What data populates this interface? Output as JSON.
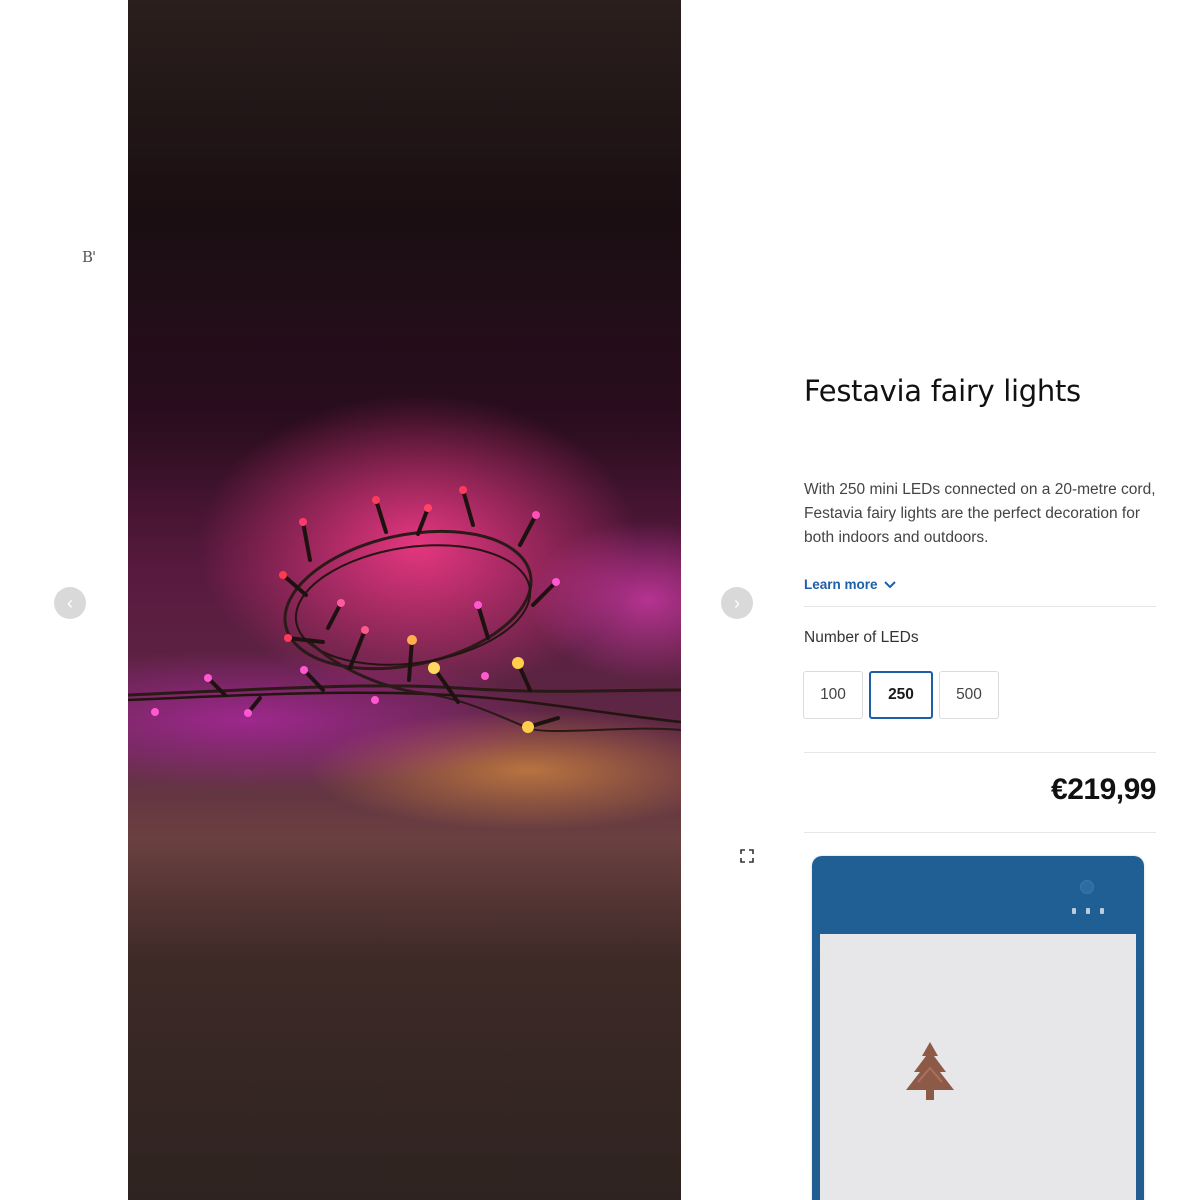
{
  "side_mark": "B'",
  "product": {
    "title": "Festavia fairy lights",
    "description": "With 250 mini LEDs connected on a 20-metre cord, Festavia fairy lights are the perfect decoration for both indoors and outdoors.",
    "learn_more_label": "Learn more",
    "option_group_label": "Number of LEDs",
    "options": [
      {
        "label": "100",
        "selected": false
      },
      {
        "label": "250",
        "selected": true
      },
      {
        "label": "500",
        "selected": false
      }
    ],
    "price": "€219,99"
  },
  "carousel": {
    "prev_icon": "chevron-left-icon",
    "next_icon": "chevron-right-icon",
    "fullscreen_icon": "expand-icon"
  },
  "colors": {
    "accent": "#1c5fa8",
    "phone_blue": "#1f5f94",
    "led_pink": "#ff4fb8",
    "led_red": "#ff3a5c",
    "led_amber": "#ffcf4a"
  }
}
